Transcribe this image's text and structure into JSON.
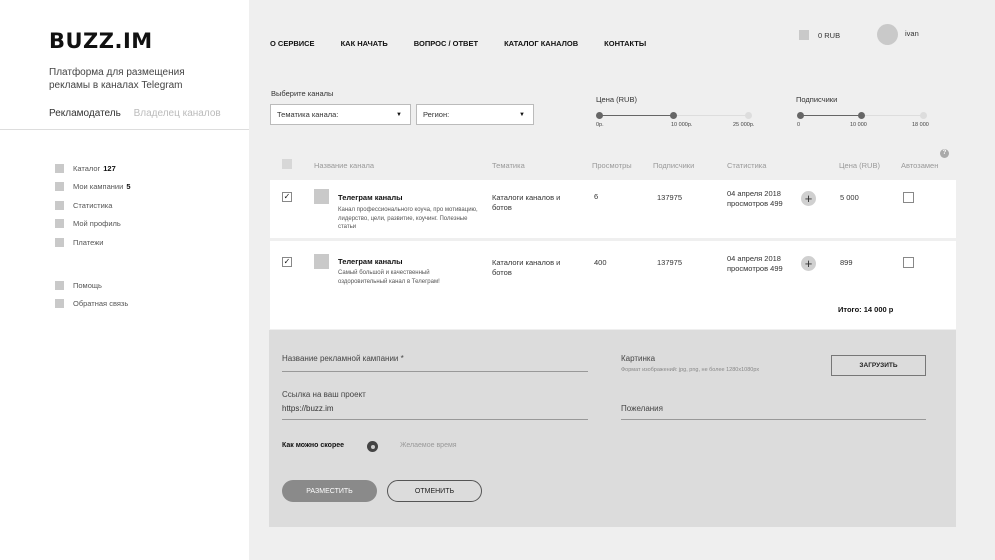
{
  "brand": {
    "logo": "BUZZ.IM",
    "tagline": "Платформа для размещения рекламы в каналах Telegram"
  },
  "roles": {
    "advertiser": "Рекламодатель",
    "owner": "Владелец каналов"
  },
  "sidebar": {
    "items": [
      {
        "label": "Каталог",
        "count": "127"
      },
      {
        "label": "Мои кампании",
        "count": "5"
      },
      {
        "label": "Статистика",
        "count": ""
      },
      {
        "label": "Мой профиль",
        "count": ""
      },
      {
        "label": "Платежи",
        "count": ""
      }
    ],
    "bottom_items": [
      {
        "label": "Помощь"
      },
      {
        "label": "Обратная связь"
      }
    ]
  },
  "top_nav": {
    "items": [
      "О СЕРВИСЕ",
      "КАК НАЧАТЬ",
      "ВОПРОС / ОТВЕТ",
      "КАТАЛОГ КАНАЛОВ",
      "КОНТАКТЫ"
    ],
    "balance": "0 RUB",
    "username": "ivan"
  },
  "filters": {
    "label": "Выберите каналы",
    "theme_select": "Тематика канала:",
    "region_select": "Регион:",
    "price": {
      "label": "Цена (RUB)",
      "ticks": [
        "0р.",
        "10 000р.",
        "25 000р."
      ],
      "selected_fraction": 0.5
    },
    "subs": {
      "label": "Подписчики",
      "ticks": [
        "0",
        "10 000",
        "18 000"
      ],
      "selected_fraction": 0.5
    }
  },
  "table": {
    "headers": {
      "name": "Название канала",
      "topic": "Тематика",
      "views": "Просмотры",
      "subs": "Подписчики",
      "stats": "Статистика",
      "price": "Цена (RUB)",
      "auto": "Автозамен"
    },
    "help": "?",
    "rows": [
      {
        "checked": "✓",
        "title": "Телеграм каналы",
        "desc": "Канал профессионального коуча, про мотивацию, лидерство, цели, развитие, коучинг. Полезные статьи",
        "topic": "Каталоги каналов и ботов",
        "views": "6",
        "subs": "137975",
        "stat_date": "04 апреля 2018",
        "stat_views": "просмотров 499",
        "plus": "+",
        "price": "5 000"
      },
      {
        "checked": "✓",
        "title": "Телеграм каналы",
        "desc": "Самый большой и качественный оздоровительный канал в Телеграм!",
        "topic": "Каталоги каналов и ботов",
        "views": "400",
        "subs": "137975",
        "stat_date": "04 апреля 2018",
        "stat_views": "просмотров 499",
        "plus": "+",
        "price": "899"
      }
    ],
    "total": "Итого: 14 000 р"
  },
  "form": {
    "campaign_label": "Название рекламной кампании *",
    "image_label": "Картинка",
    "image_hint": "Формат изображений: jpg, png, не более 1280x1080px",
    "upload": "ЗАГРУЗИТЬ",
    "link_label": "Ссылка на ваш проект",
    "link_value": "https://buzz.im",
    "wishes_label": "Пожелания",
    "asap": "Как можно скорее",
    "desired_time": "Желаемое время",
    "place": "РАЗМЕСТИТЬ",
    "cancel": "ОТМЕНИТЬ"
  }
}
